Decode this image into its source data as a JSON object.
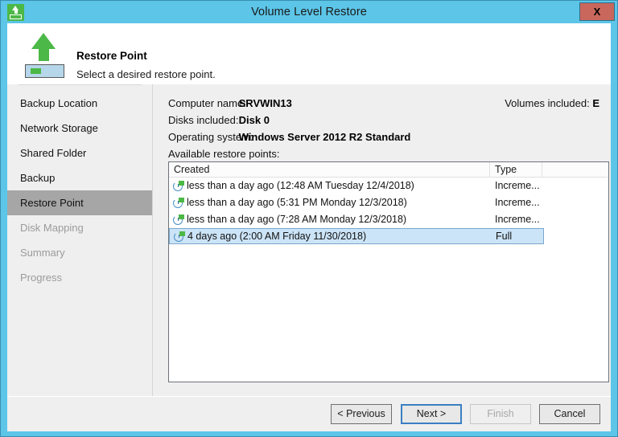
{
  "window": {
    "title": "Volume Level Restore",
    "app_icon": "restore-drive-icon",
    "close_label": "X"
  },
  "header": {
    "icon": "green-up-arrow-drive-icon",
    "title": "Restore Point",
    "subtitle": "Select a desired restore point."
  },
  "sidebar": {
    "items": [
      {
        "label": "Backup Location",
        "state": "normal"
      },
      {
        "label": "Network Storage",
        "state": "normal"
      },
      {
        "label": "Shared Folder",
        "state": "normal"
      },
      {
        "label": "Backup",
        "state": "normal"
      },
      {
        "label": "Restore Point",
        "state": "selected"
      },
      {
        "label": "Disk Mapping",
        "state": "disabled"
      },
      {
        "label": "Summary",
        "state": "disabled"
      },
      {
        "label": "Progress",
        "state": "disabled"
      }
    ]
  },
  "content": {
    "computer_name_label": "Computer name:",
    "computer_name_value": "SRVWIN13",
    "disks_included_label": "Disks included:",
    "disks_included_value": "Disk 0",
    "operating_system_label": "Operating system:",
    "operating_system_value": "Windows Server 2012 R2 Standard",
    "volumes_included_label": "Volumes included:",
    "volumes_included_value": "E",
    "available_restore_points_label": "Available restore points:"
  },
  "restore_points": {
    "columns": [
      "Created",
      "Type",
      ""
    ],
    "rows": [
      {
        "icon": "restore-point-clock-icon",
        "created": "less than a day ago (12:48 AM Tuesday 12/4/2018)",
        "type": "Increme...",
        "selected": false
      },
      {
        "icon": "restore-point-clock-icon",
        "created": "less than a day ago (5:31 PM Monday 12/3/2018)",
        "type": "Increme...",
        "selected": false
      },
      {
        "icon": "restore-point-clock-icon",
        "created": "less than a day ago (7:28 AM Monday 12/3/2018)",
        "type": "Increme...",
        "selected": false
      },
      {
        "icon": "restore-point-clock-icon",
        "created": "4 days ago (2:00 AM Friday 11/30/2018)",
        "type": "Full",
        "selected": true
      }
    ]
  },
  "footer": {
    "previous_label": "< Previous",
    "next_label": "Next >",
    "finish_label": "Finish",
    "cancel_label": "Cancel"
  },
  "colors": {
    "title_bar": "#5cc5e8",
    "close_button": "#c9675c",
    "accent_green": "#4cb847",
    "selection_blue": "#cce4f7",
    "sidebar_selected": "#a6a6a6",
    "dialog_bg": "#efefef"
  }
}
